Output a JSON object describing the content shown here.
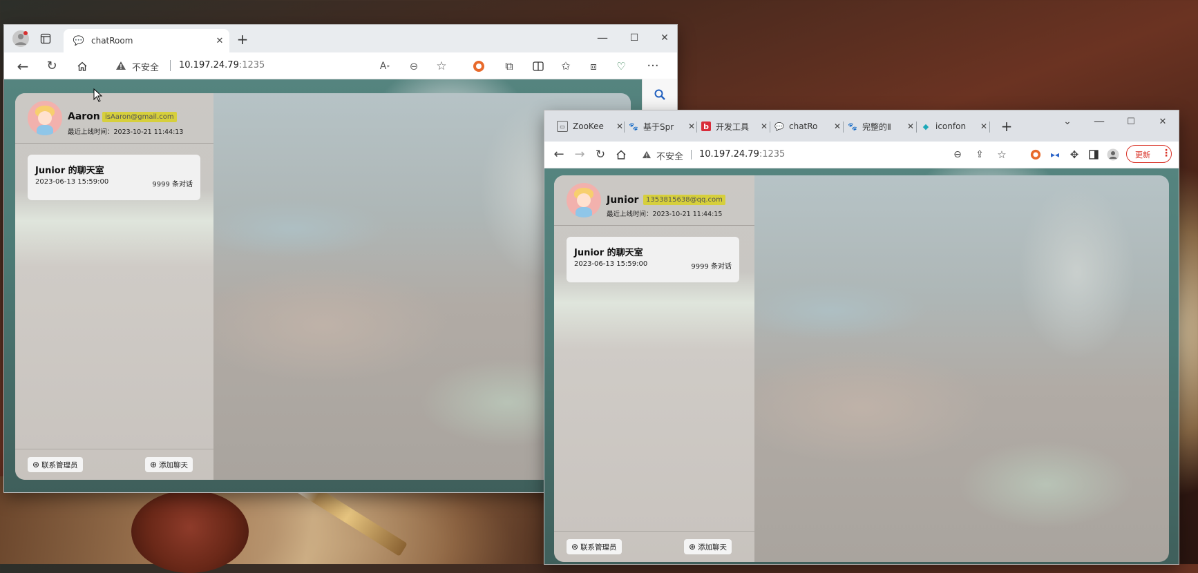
{
  "edge": {
    "tab_title": "chatRoom",
    "security_label": "不安全",
    "url_host": "10.197.24.79",
    "url_port": ":1235",
    "window_buttons": [
      "—",
      "☐",
      "✕"
    ],
    "toolbar_icons": [
      "read-aloud-icon",
      "zoom-out-icon",
      "favorite-star-icon",
      "extension-o-icon",
      "puzzle-icon",
      "split-screen-icon",
      "favorites-icon",
      "collections-icon",
      "browser-essentials-icon",
      "more-icon"
    ],
    "sidebar_icon": "search-icon"
  },
  "edge_app": {
    "user": {
      "name": "Aaron",
      "email": "isAaron@gmail.com",
      "last_seen": "最近上线时间：2023-10-21 11:44:13"
    },
    "rooms": [
      {
        "title": "Junior 的聊天室",
        "date": "2023-06-13 15:59:00",
        "count": "9999 条对话"
      }
    ],
    "footer": {
      "contact_label": "联系管理员",
      "add_label": "添加聊天"
    }
  },
  "chrome": {
    "tabs": [
      {
        "title": "ZooKee",
        "icon": "zookeeper-icon"
      },
      {
        "title": "基于Spr",
        "icon": "baidu-paw-icon"
      },
      {
        "title": "开发工具",
        "icon": "b-logo-icon"
      },
      {
        "title": "chatRo",
        "icon": "chat-bubble-icon"
      },
      {
        "title": "完整的Ⅱ",
        "icon": "baidu-paw-icon"
      },
      {
        "title": "iconfon",
        "icon": "iconfont-icon"
      }
    ],
    "new_tab": "+",
    "security_label": "不安全",
    "url_host": "10.197.24.79",
    "url_port": ":1235",
    "update_label": "更新",
    "window_buttons": [
      "⌄",
      "—",
      "☐",
      "✕"
    ]
  },
  "chrome_app": {
    "user": {
      "name": "Junior",
      "email": "1353815638@qq.com",
      "last_seen": "最近上线时间：2023-10-21 11:44:15"
    },
    "rooms": [
      {
        "title": "Junior 的聊天室",
        "date": "2023-06-13 15:59:00",
        "count": "9999 条对话"
      }
    ],
    "footer": {
      "contact_label": "联系管理员",
      "add_label": "添加聊天"
    }
  }
}
